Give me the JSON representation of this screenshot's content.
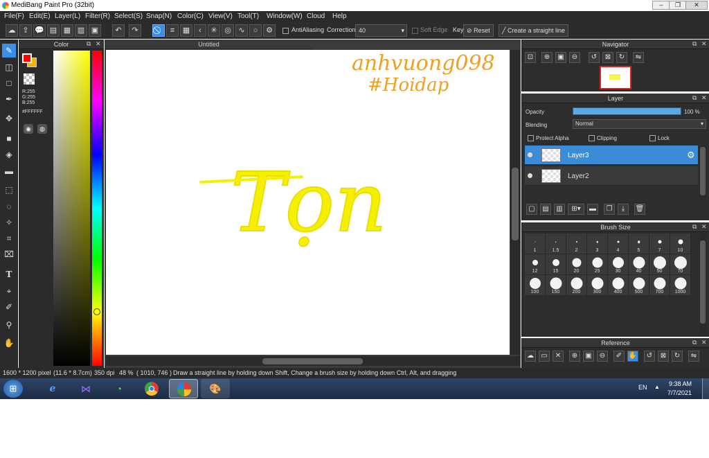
{
  "window": {
    "title": "MediBang Paint Pro (32bit)"
  },
  "menu": [
    "File(F)",
    "Edit(E)",
    "Layer(L)",
    "Filter(R)",
    "Select(S)",
    "Snap(N)",
    "Color(C)",
    "View(V)",
    "Tool(T)",
    "Window(W)",
    "Cloud",
    "Help"
  ],
  "toolbar": {
    "antialiasing_label": "AntiAliasing",
    "correction_label": "Correction",
    "correction_value": "40",
    "soft_edge_label": "Soft Edge",
    "key_label": "Key",
    "reset_label": "Reset",
    "straight_line_label": "Create a straight line"
  },
  "color_panel": {
    "title": "Color",
    "r": "R:255",
    "g": "G:255",
    "b": "B:255",
    "hex": "#FFFFFF",
    "foreground_color": "#ff0000",
    "background_color": "#f5b400"
  },
  "document": {
    "tab_title": "Untitled",
    "handwriting_line1": "anhvuong098",
    "handwriting_line2": "#Hoidap",
    "drawing_text": "Tọn"
  },
  "navigator": {
    "title": "Navigator"
  },
  "layer_panel": {
    "title": "Layer",
    "opacity_label": "Opacity",
    "opacity_value": "100 %",
    "opacity_fraction": 1.0,
    "blending_label": "Blending",
    "blending_value": "Normal",
    "protect_alpha_label": "Protect Alpha",
    "clipping_label": "Clipping",
    "lock_label": "Lock",
    "layers": [
      {
        "name": "Layer3",
        "selected": true
      },
      {
        "name": "Layer2",
        "selected": false
      }
    ]
  },
  "brush_size": {
    "title": "Brush Size",
    "sizes": [
      "1",
      "1.5",
      "2",
      "3",
      "4",
      "5",
      "7",
      "10",
      "12",
      "15",
      "20",
      "25",
      "30",
      "40",
      "50",
      "70",
      "100",
      "150",
      "200",
      "300",
      "400",
      "500",
      "700",
      "1000"
    ]
  },
  "reference": {
    "title": "Reference"
  },
  "status": {
    "canvas_size": "1600 * 1200 pixel",
    "physical_size": "(11.6 * 8.7cm)",
    "dpi": "350 dpi",
    "zoom": "48 %",
    "cursor": "( 1010, 746 )",
    "hint": "Draw a straight line by holding down Shift, Change a brush size by holding down Ctrl, Alt, and dragging"
  },
  "taskbar": {
    "language": "EN",
    "time": "9:38 AM",
    "date": "7/7/2021"
  },
  "colors": {
    "accent": "#3a8ee6",
    "drawing_yellow": "#f5f000",
    "handwriting_orange": "#f0a020"
  }
}
